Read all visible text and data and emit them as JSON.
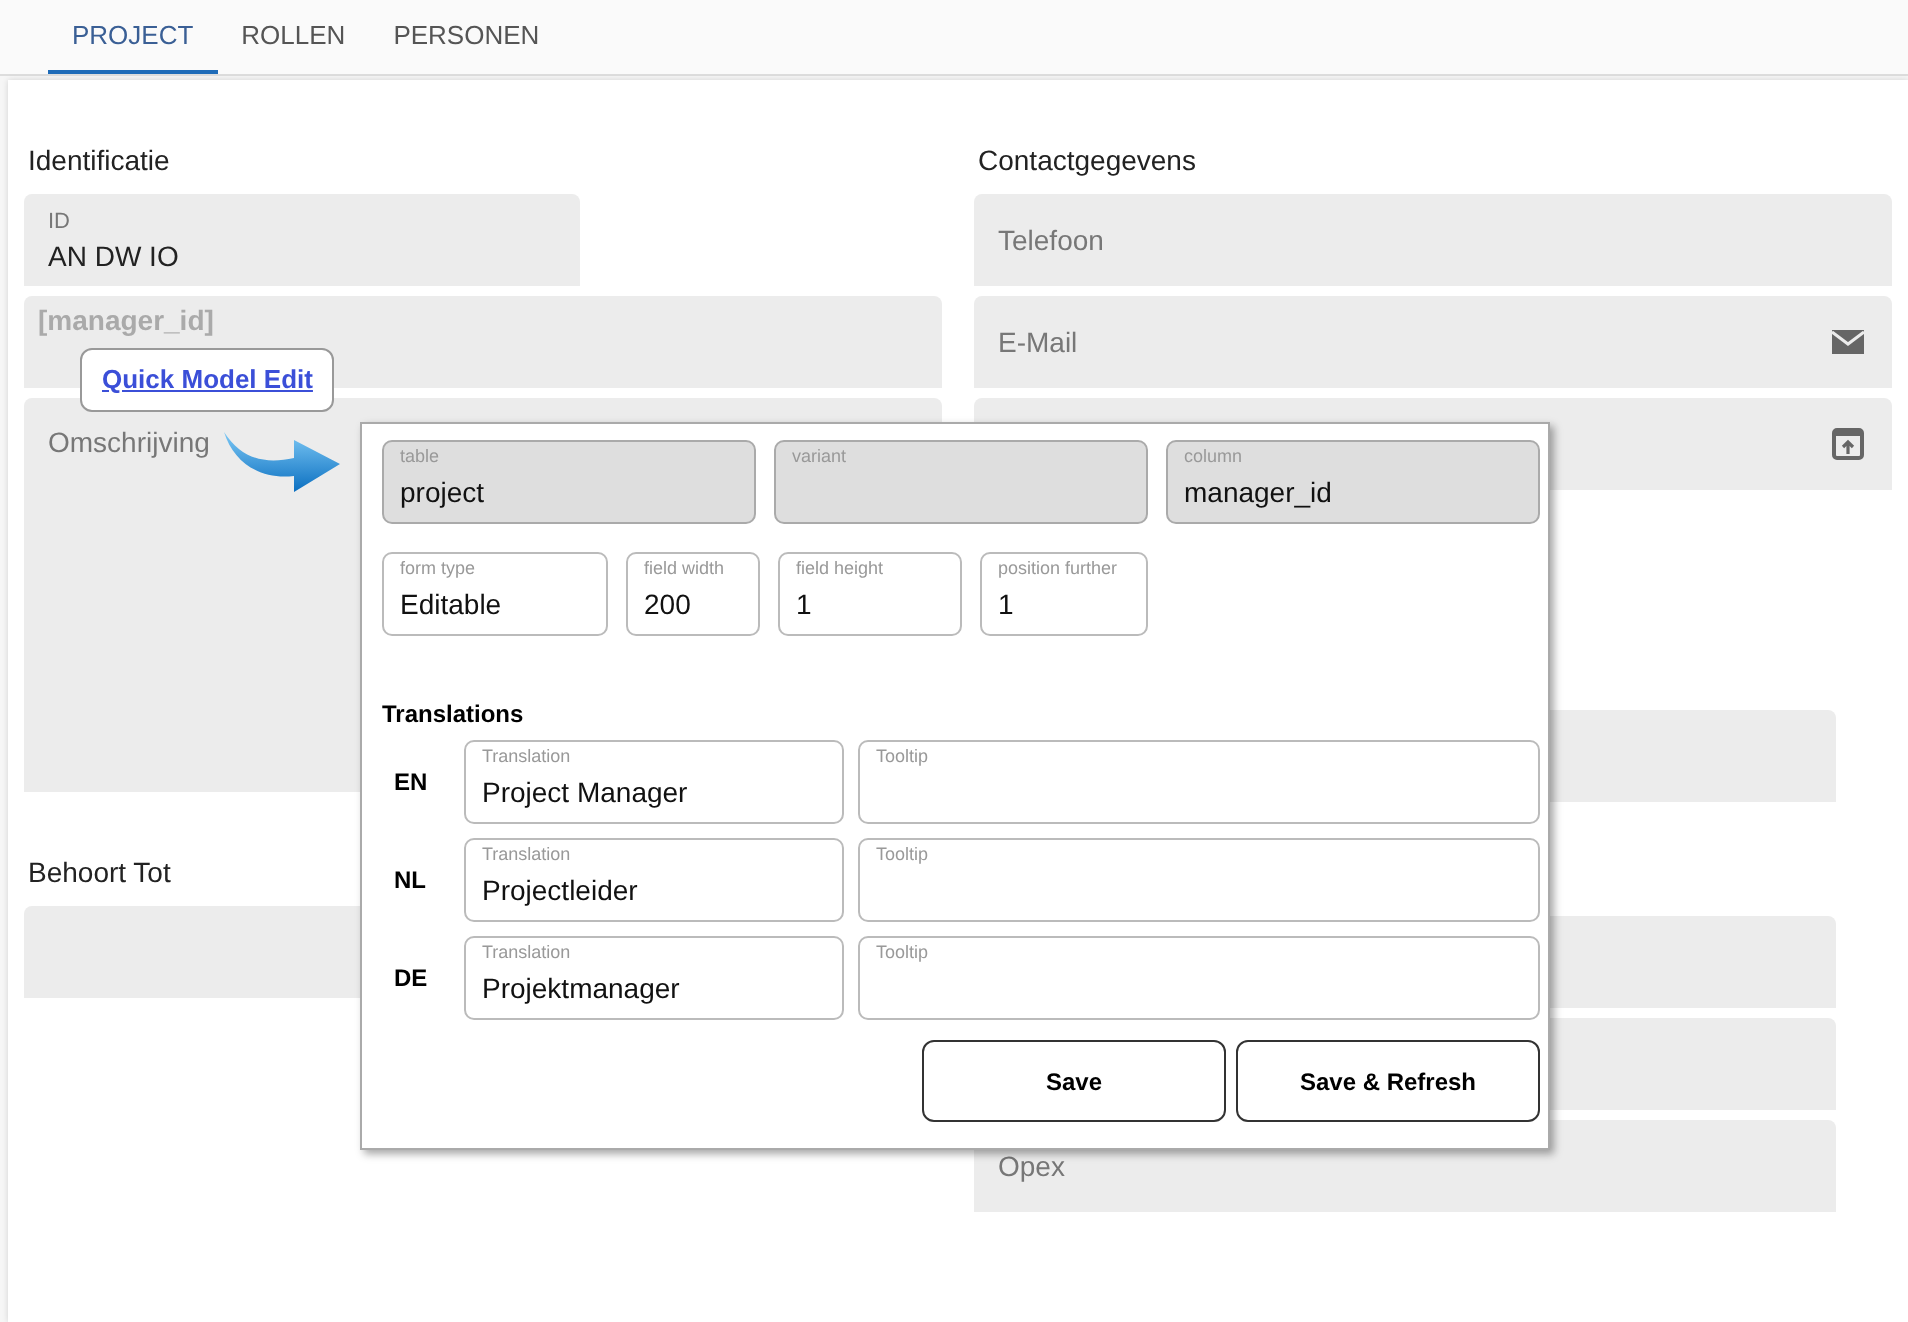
{
  "tabs": [
    {
      "label": "PROJECT",
      "selected": true
    },
    {
      "label": "ROLLEN",
      "selected": false
    },
    {
      "label": "PERSONEN",
      "selected": false
    }
  ],
  "left_sections": [
    {
      "heading": "Identificatie",
      "fields": [
        {
          "kind": "short",
          "label": "ID",
          "value": "AN DW IO"
        },
        {
          "kind": "tagged",
          "label": "[manager_id]"
        },
        {
          "kind": "area",
          "placeholder": "Omschrijving"
        }
      ]
    },
    {
      "heading": "Behoort Tot",
      "fields": [
        {
          "kind": "text"
        }
      ]
    }
  ],
  "right_sections": [
    {
      "heading": "Contactgegevens",
      "fields": [
        {
          "kind": "text",
          "placeholder": "Telefoon"
        },
        {
          "kind": "email",
          "placeholder": "E-Mail"
        },
        {
          "kind": "url"
        }
      ]
    },
    {
      "fields": [
        {
          "kind": "text"
        }
      ]
    },
    {
      "fields": [
        {
          "kind": "text"
        },
        {
          "kind": "text"
        },
        {
          "kind": "text",
          "placeholder": "Opex"
        }
      ]
    }
  ],
  "quick_edit_link": "Quick Model Edit",
  "popup": {
    "model_fields": [
      {
        "label": "table",
        "value": "project"
      },
      {
        "label": "variant"
      },
      {
        "label": "column",
        "value": "manager_id"
      }
    ],
    "form_fields": [
      {
        "label": "form type",
        "value": "Editable"
      },
      {
        "label": "field width",
        "value": "200"
      },
      {
        "label": "field height",
        "value": "1"
      },
      {
        "label": "position further",
        "value": "1"
      }
    ],
    "translations_heading": "Translations",
    "translations": [
      {
        "language": "EN",
        "translation_label": "Translation",
        "translation": "Project Manager",
        "tooltip_label": "Tooltip"
      },
      {
        "language": "NL",
        "translation_label": "Translation",
        "translation": "Projectleider",
        "tooltip_label": "Tooltip"
      },
      {
        "language": "DE",
        "translation_label": "Translation",
        "translation": "Projektmanager",
        "tooltip_label": "Tooltip"
      }
    ],
    "buttons": [
      "Save",
      "Save & Refresh"
    ]
  }
}
